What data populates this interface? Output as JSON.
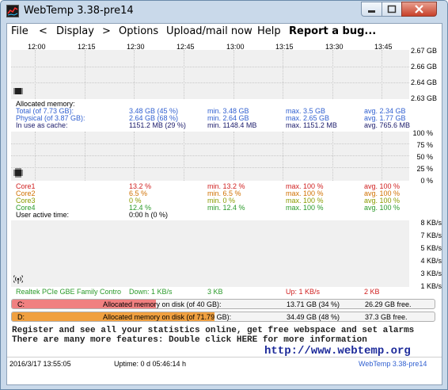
{
  "window": {
    "title": "WebTemp 3.38-pre14",
    "icon": "webtemp-app-icon"
  },
  "menu": [
    "File",
    "<",
    "Display",
    ">",
    "Options",
    "Upload/mail now",
    "Help",
    "Report a bug..."
  ],
  "memory_graph": {
    "time_labels": [
      "12:00",
      "12:15",
      "12:30",
      "12:45",
      "13:00",
      "13:15",
      "13:30",
      "13:45"
    ],
    "axis_labels": [
      "2.67 GB",
      "2.66 GB",
      "2.64 GB",
      "2.63 GB"
    ],
    "icon": "memory-chip-icon"
  },
  "memory": {
    "header": "Allocated memory:",
    "rows": [
      {
        "label": "Total (of 7.73 GB):",
        "value": "3.48 GB (45 %)",
        "min": "min. 3.48 GB",
        "max": "max. 3.5 GB",
        "avg": "avg. 2.34 GB"
      },
      {
        "label": "Physical (of 3.87 GB):",
        "value": "2.64 GB (68 %)",
        "min": "min. 2.64 GB",
        "max": "max. 2.65 GB",
        "avg": "avg. 1.77 GB"
      },
      {
        "label": "In use as cache:",
        "value": "1151.2 MB (29 %)",
        "min": "min. 1148.4 MB",
        "max": "max. 1151.2 MB",
        "avg": "avg. 765.6 MB"
      }
    ]
  },
  "cpu_graph": {
    "axis_labels": [
      "100 %",
      "75 %",
      "50 %",
      "25 %",
      "0 %"
    ],
    "icon": "cpu-chip-icon"
  },
  "cpu": {
    "rows": [
      {
        "label": "Core1",
        "value": "13.2 %",
        "min": "min. 13.2 %",
        "max": "max. 100 %",
        "avg": "avg. 100 %"
      },
      {
        "label": "Core2",
        "value": "6.5 %",
        "min": "min. 6.5 %",
        "max": "max. 100 %",
        "avg": "avg. 100 %"
      },
      {
        "label": "Core3",
        "value": "0 %",
        "min": "min. 0 %",
        "max": "max. 100 %",
        "avg": "avg. 100 %"
      },
      {
        "label": "Core4",
        "value": "12.4 %",
        "min": "min. 12.4 %",
        "max": "max. 100 %",
        "avg": "avg. 100 %"
      }
    ],
    "active_label": "User active time:",
    "active_value": "0:00 h (0 %)"
  },
  "net_graph": {
    "axis_labels": [
      "8 KB/s",
      "7 KB/s",
      "5 KB/s",
      "4 KB/s",
      "3 KB/s",
      "1 KB/s"
    ],
    "icon": "network-antenna-icon"
  },
  "network": {
    "adapter": "Realtek PCIe GBE Family Contro",
    "down": "Down: 1 KB/s",
    "down_total": "3 KB",
    "up": "Up: 1 KB/s",
    "up_total": "2 KB"
  },
  "disks": [
    {
      "drive": "C:",
      "label": "Allocated memory on disk (of 40 GB):",
      "used": "13.71 GB (34 %)",
      "free": "26.29 GB free.",
      "percent": 34,
      "color": "#f08080"
    },
    {
      "drive": "D:",
      "label": "Allocated memory on disk (of 71.79 GB):",
      "used": "34.49 GB (48 %)",
      "free": "37.3 GB free.",
      "percent": 48,
      "color": "#f0a040"
    }
  ],
  "promo": {
    "line1": "Register and see all your statistics online, get free webspace and set alarms",
    "line2": "There are many more features: Double click HERE for more information",
    "url": "http://www.webtemp.org"
  },
  "status": {
    "datetime": "2016/3/17  13:55:05",
    "uptime": "Uptime: 0 d 05:46:14 h",
    "version": "WebTemp 3.38-pre14"
  },
  "colors": {
    "memory_total": "#2f5fd0",
    "memory_cache": "#1a1a6a",
    "core1": "#d02020",
    "core2": "#d07000",
    "core3": "#8a9a00",
    "core4": "#2a9a2a"
  }
}
